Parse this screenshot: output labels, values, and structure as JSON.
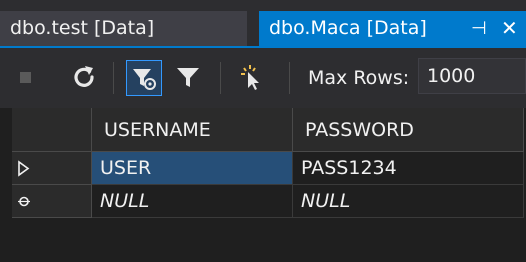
{
  "tabs": [
    {
      "label": "dbo.test [Data]",
      "active": false
    },
    {
      "label": "dbo.Maca [Data]",
      "active": true
    }
  ],
  "tab_controls": {
    "pin_glyph": "⊣",
    "close_glyph": "✕"
  },
  "toolbar": {
    "max_rows_label": "Max Rows:",
    "max_rows_value": "1000"
  },
  "grid": {
    "columns": [
      "USERNAME",
      "PASSWORD"
    ],
    "rows": [
      {
        "indicator": "current-row-arrow",
        "cells": [
          "USER",
          "PASS1234"
        ]
      },
      {
        "indicator": "new-row-marker",
        "cells": [
          "NULL",
          "NULL"
        ]
      }
    ]
  },
  "colors": {
    "accent": "#007acc",
    "selection": "#264f78",
    "background": "#1f1f1f"
  }
}
